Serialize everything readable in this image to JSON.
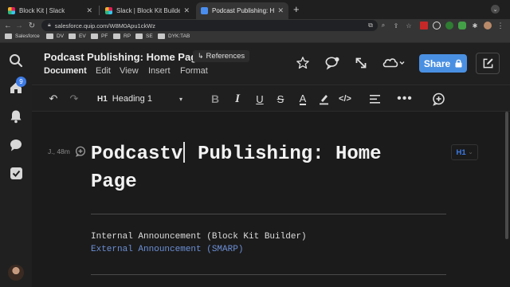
{
  "browser": {
    "tabs": [
      {
        "title": "Block Kit | Slack",
        "active": false
      },
      {
        "title": "Slack | Block Kit Builder",
        "active": false
      },
      {
        "title": "Podcast Publishing: Home Page",
        "active": true
      }
    ],
    "new_tab": "+",
    "url": "salesforce.quip.com/W8M0Apu1ckWz",
    "bookmarks": [
      "Salesforce",
      "DV",
      "EV",
      "PF",
      "RP",
      "SE",
      "DYK:TAB"
    ]
  },
  "sidebar": {
    "badge_count": "9"
  },
  "header": {
    "doc_title": "Podcast Publishing: Home Page",
    "references_label": "References",
    "menu": [
      "Document",
      "Edit",
      "View",
      "Insert",
      "Format"
    ],
    "share_label": "Share"
  },
  "toolbar": {
    "style_prefix": "H1",
    "style_label": "Heading 1"
  },
  "doc": {
    "author_meta": "J., 48m",
    "title_word1": "Podcastv",
    "title_rest": "Publishing: Home",
    "title_line2": "Page",
    "style_badge": "H1",
    "line1": "Internal Announcement (Block Kit Builder)",
    "line2": "External Announcement (SMARP)"
  },
  "colors": {
    "accent_blue": "#4a90e2",
    "link_blue": "#6b8fd6",
    "badge_blue": "#3d7be6"
  }
}
